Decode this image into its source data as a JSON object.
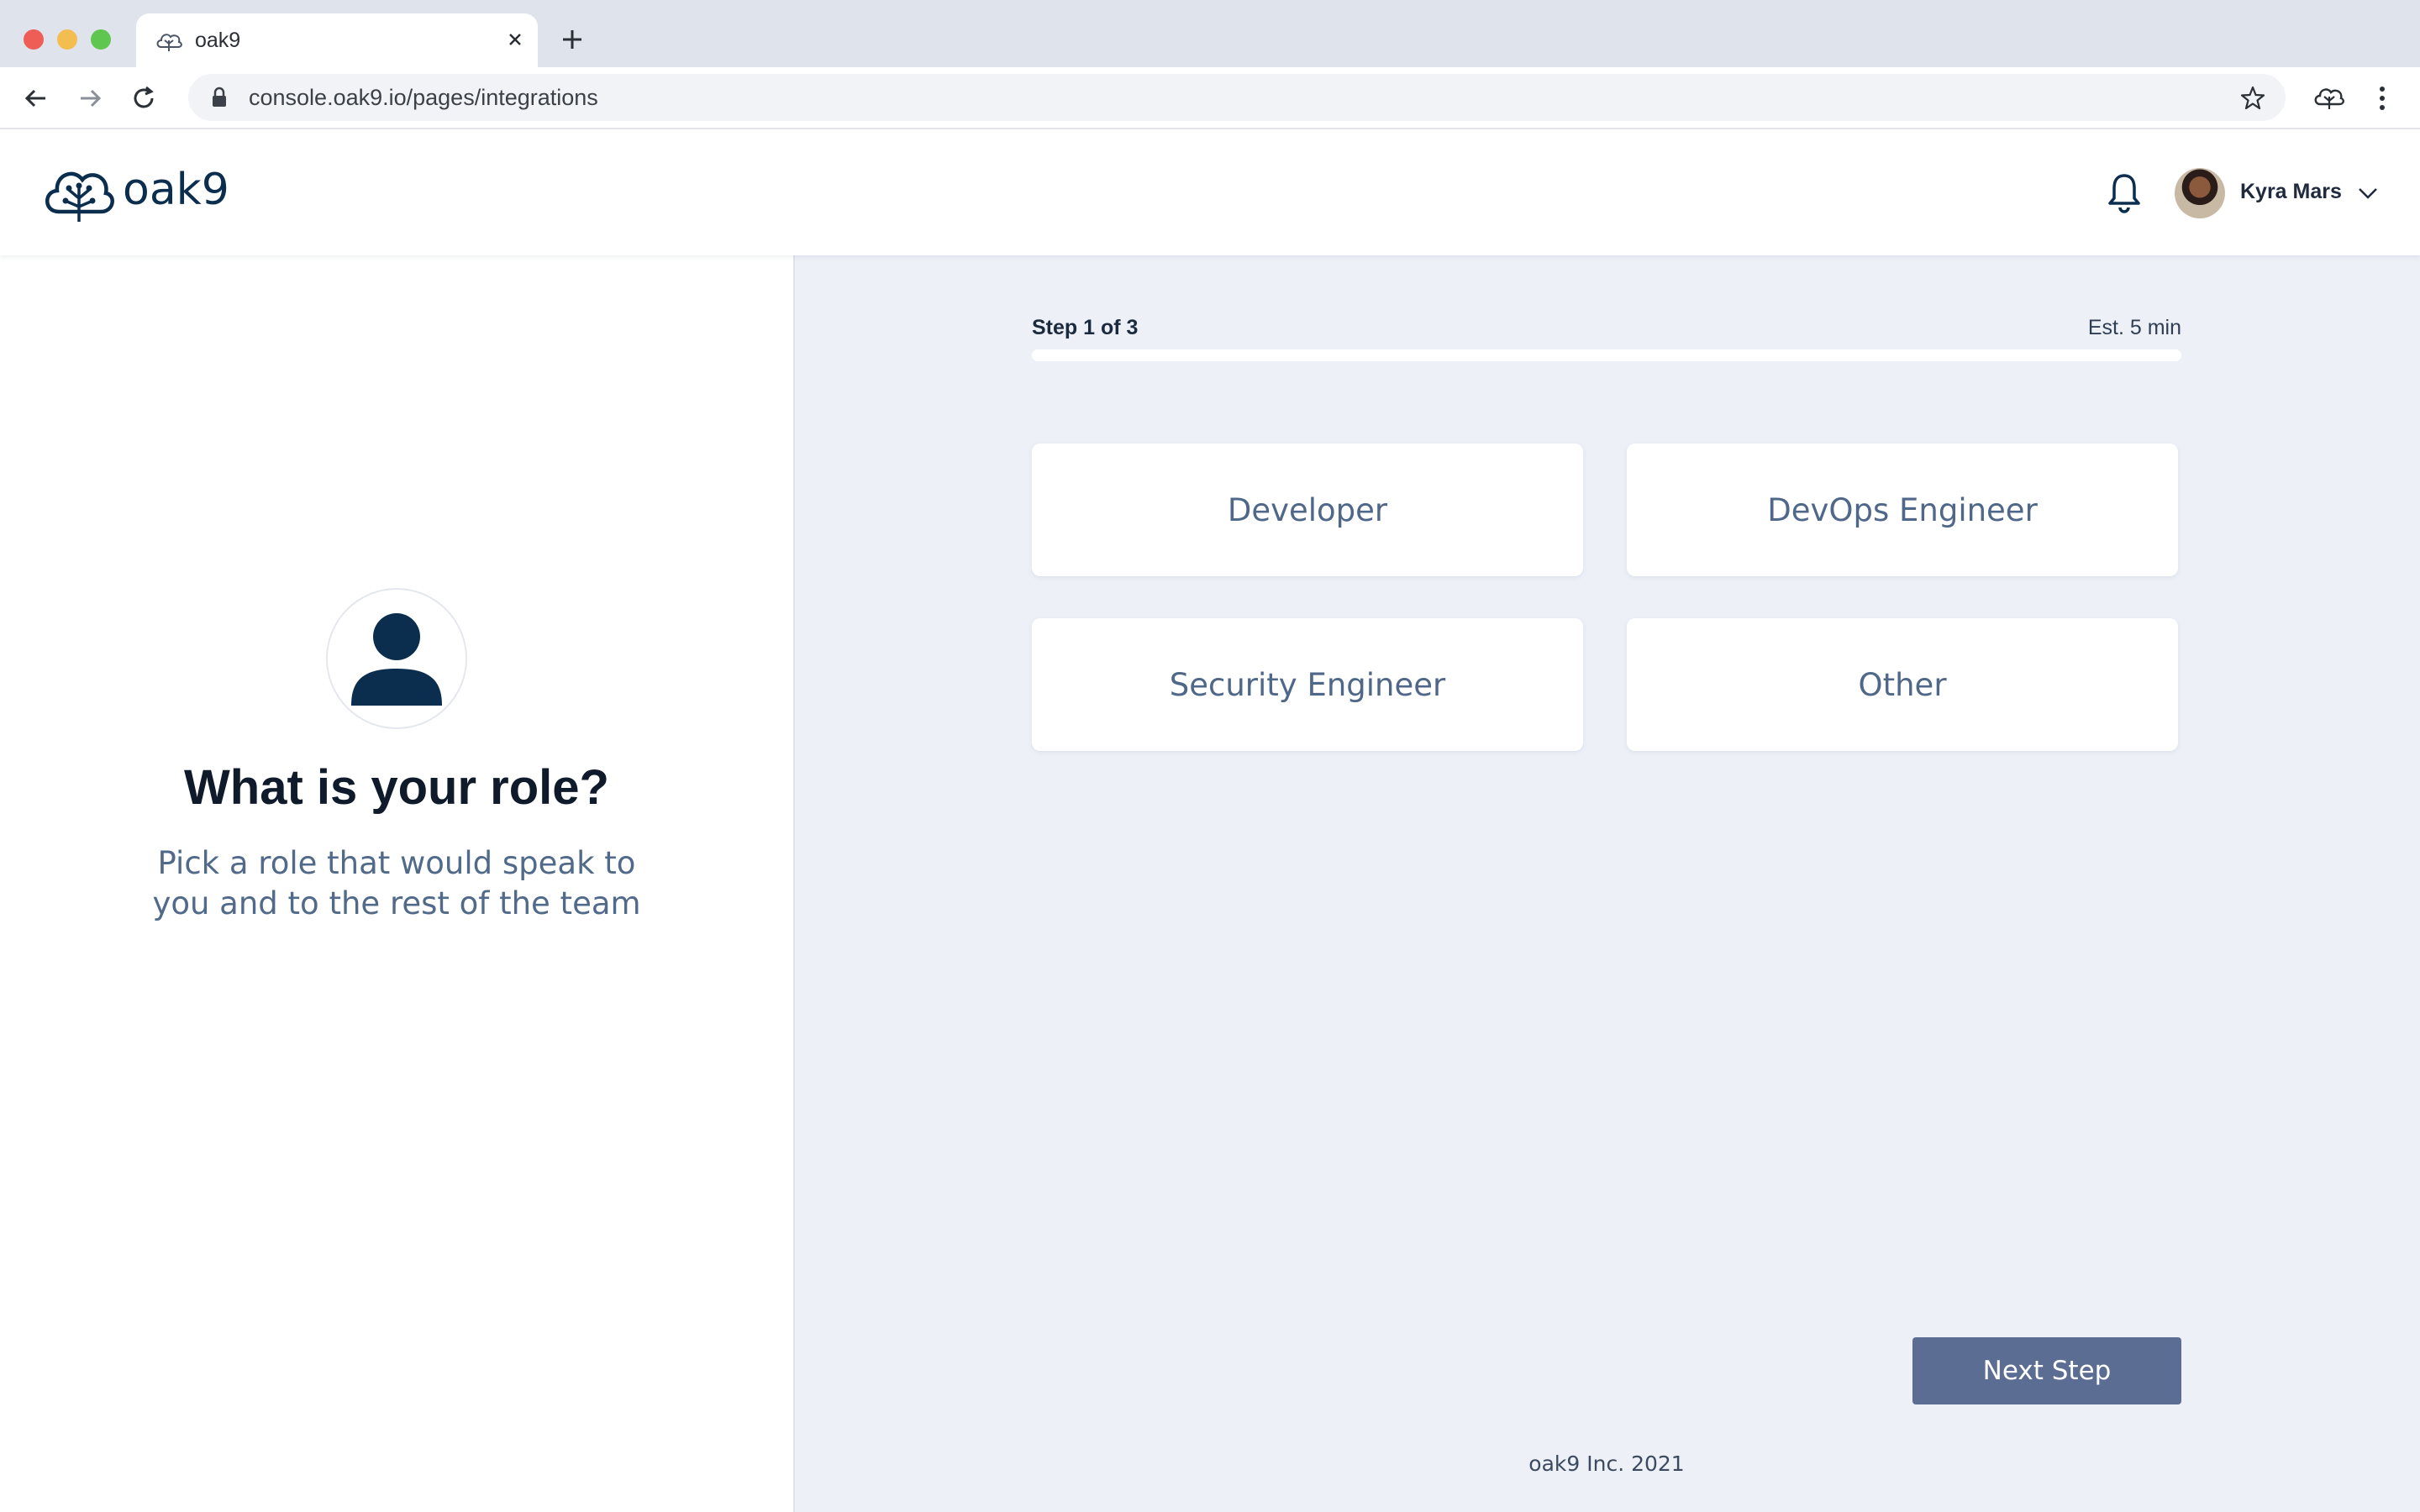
{
  "browser": {
    "tab_title": "oak9",
    "url": "console.oak9.io/pages/integrations"
  },
  "header": {
    "logo_text": "oak9",
    "user_name": "Kyra Mars"
  },
  "left_panel": {
    "title": "What is your role?",
    "subtitle": "Pick a role that would speak to you and to the rest of the team"
  },
  "progress": {
    "step_label": "Step 1 of 3",
    "estimate_label": "Est. 5 min",
    "fraction": 0
  },
  "roles": [
    {
      "label": "Developer"
    },
    {
      "label": "DevOps Engineer"
    },
    {
      "label": "Security Engineer"
    },
    {
      "label": "Other"
    }
  ],
  "next_button_label": "Next Step",
  "footer_text": "oak9 Inc. 2021",
  "colors": {
    "brand_navy": "#0b2e4f",
    "accent_button": "#5b6d92",
    "panel_background": "#edf0f7",
    "role_text": "#4f6788"
  },
  "icons": {
    "logo": "tree-cloud-icon",
    "notifications": "bell-icon",
    "account_menu": "chevron-down-icon",
    "role_placeholder": "user-icon"
  }
}
